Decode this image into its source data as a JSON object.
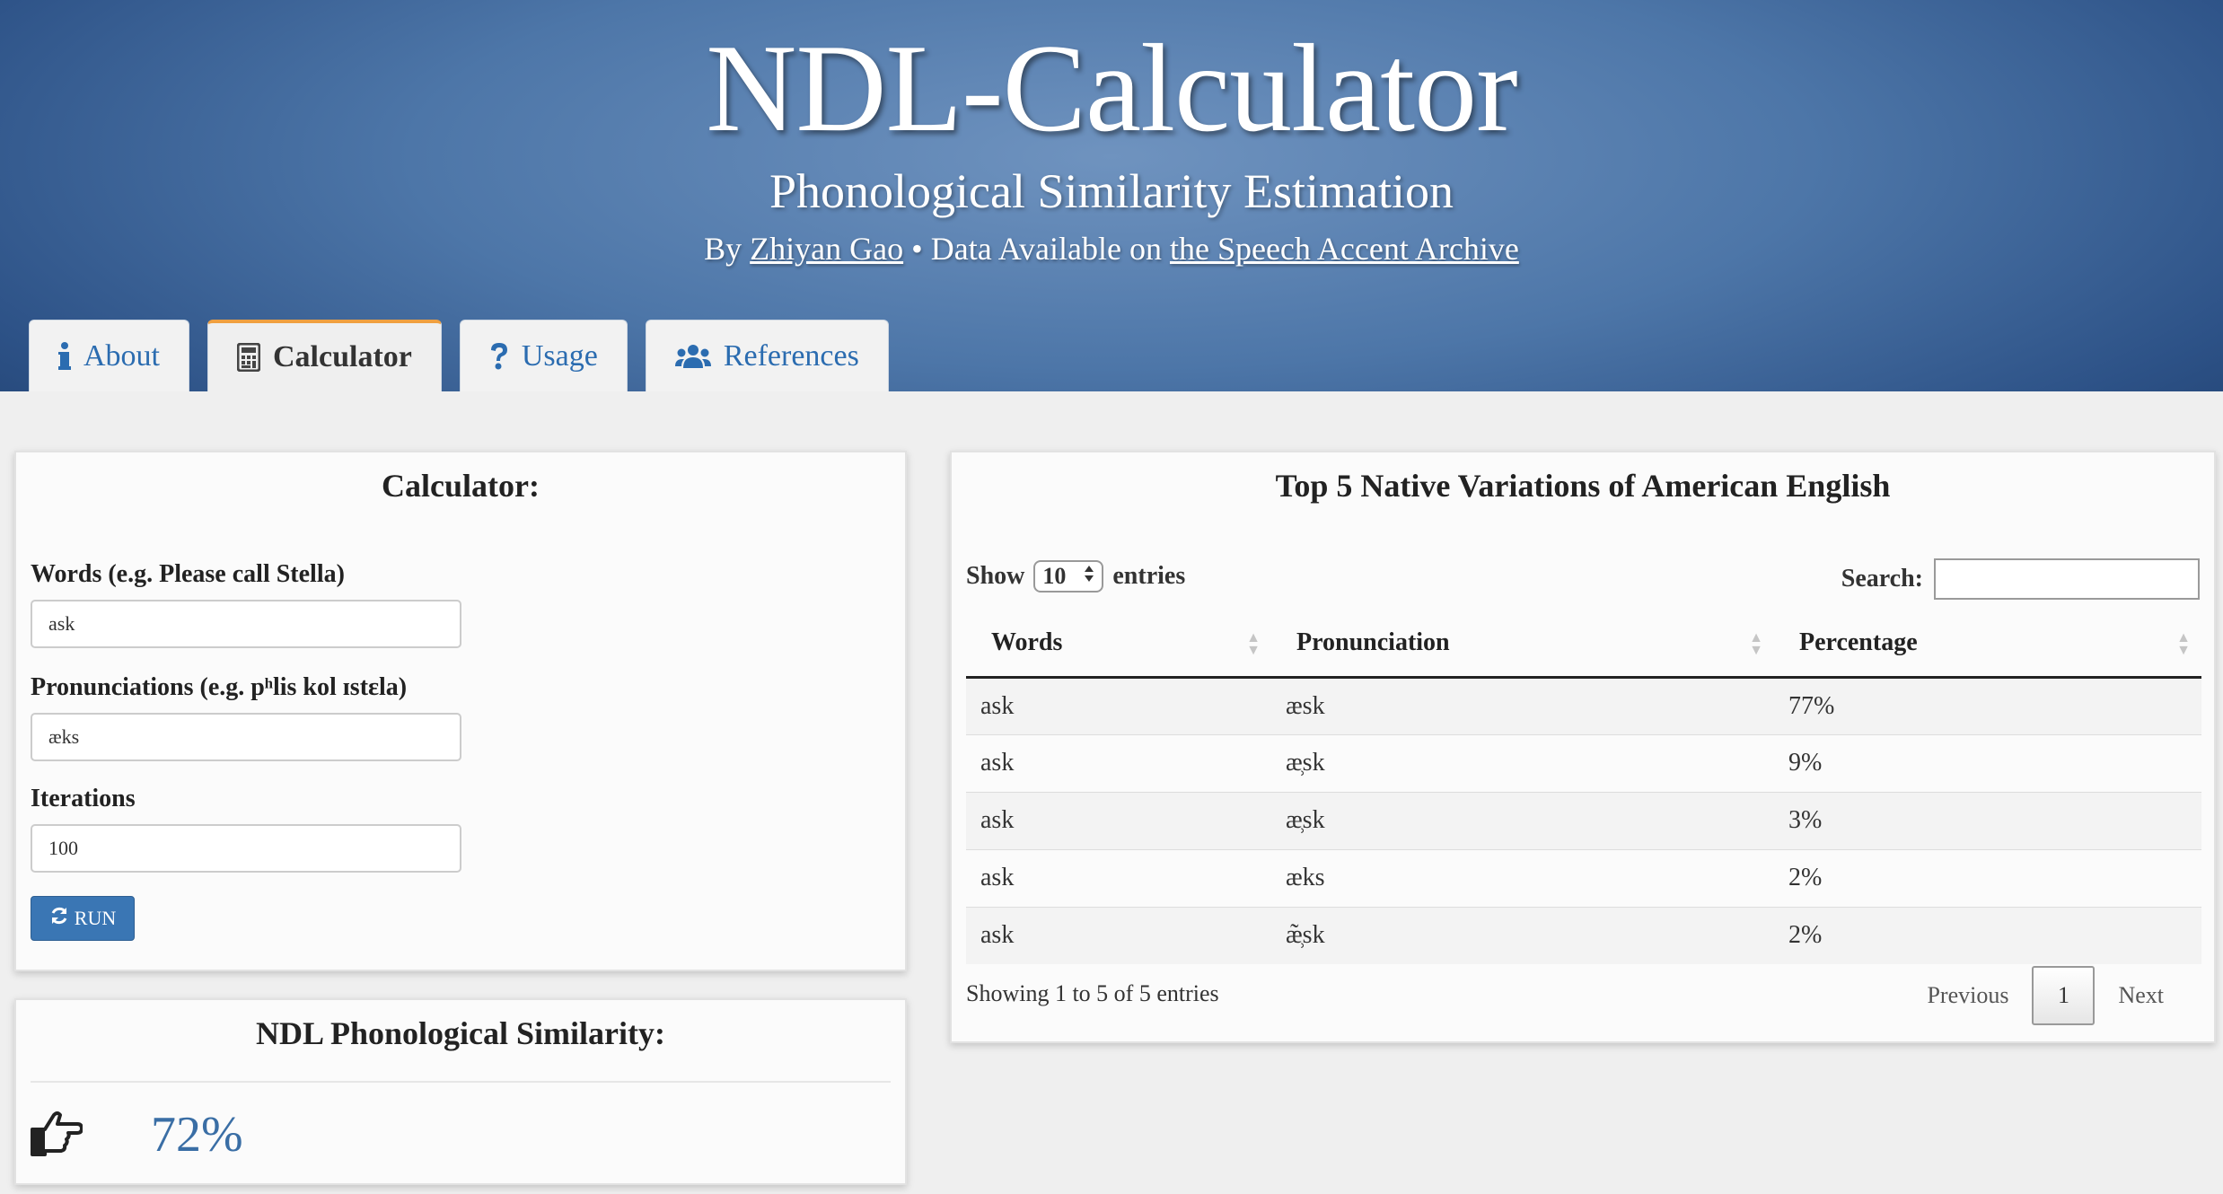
{
  "header": {
    "title": "NDL-Calculator",
    "subtitle": "Phonological Similarity Estimation",
    "by": "By",
    "author": "Zhiyan Gao",
    "separator": "• Data Available on",
    "archive_link": "the Speech Accent Archive"
  },
  "tabs": [
    {
      "label": "About",
      "icon": "info-icon"
    },
    {
      "label": "Calculator",
      "icon": "calculator-icon"
    },
    {
      "label": "Usage",
      "icon": "question-icon"
    },
    {
      "label": "References",
      "icon": "users-icon"
    }
  ],
  "active_tab": "Calculator",
  "calculator": {
    "title": "Calculator:",
    "words_label": "Words (e.g. Please call Stella)",
    "words_value": "ask",
    "pron_label": "Pronunciations (e.g. pʰlis kol ɪstɛla)",
    "pron_value": "æks",
    "iter_label": "Iterations",
    "iter_value": "100",
    "run_label": "RUN"
  },
  "similarity": {
    "title": "NDL Phonological Similarity:",
    "value": "72%"
  },
  "variations": {
    "title": "Top 5 Native Variations of American English",
    "show": "Show",
    "length": "10",
    "entries": "entries",
    "search_label": "Search:",
    "columns": [
      "Words",
      "Pronunciation",
      "Percentage"
    ],
    "rows": [
      [
        "ask",
        "æsk",
        "77%"
      ],
      [
        "ask",
        "æ̹sk",
        "9%"
      ],
      [
        "ask",
        "æ̹sk",
        "3%"
      ],
      [
        "ask",
        "æks",
        "2%"
      ],
      [
        "ask",
        "æ̹̃sk",
        "2%"
      ]
    ],
    "info": "Showing 1 to 5 of 5 entries",
    "previous": "Previous",
    "page": "1",
    "next": "Next"
  },
  "colors": {
    "header_blue": "#4d76a8",
    "link_blue": "#2b6cb0",
    "active_tab_accent": "#f0a040",
    "run_button": "#3a76b4",
    "similarity_value": "#3a6ea5"
  }
}
